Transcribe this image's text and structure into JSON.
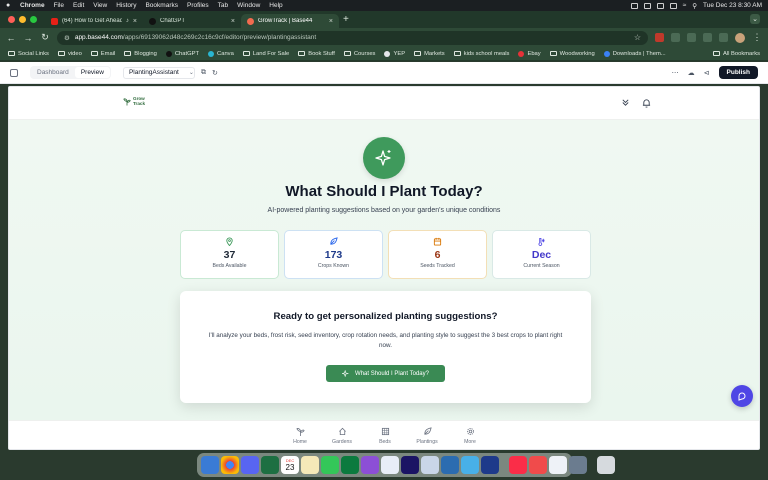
{
  "menubar": {
    "app": "Chrome",
    "menus": [
      "File",
      "Edit",
      "View",
      "History",
      "Bookmarks",
      "Profiles",
      "Tab",
      "Window",
      "Help"
    ],
    "clock": "Tue Dec 23  8:30 AM"
  },
  "browser": {
    "tabs": [
      {
        "title": "(64) How to Get Ahead o",
        "active": false
      },
      {
        "title": "ChatGPT",
        "active": false
      },
      {
        "title": "GrowTrack | Base44",
        "active": true
      }
    ],
    "url_domain": "app.base44.com",
    "url_path": "/apps/69139062d48c269c2c16c9cf/editor/preview/plantingassistant",
    "bookmarks": [
      "Social Links",
      "video",
      "Email",
      "Blogging",
      "ChatGPT",
      "Canva",
      "Land For Sale",
      "Book Stuff",
      "Courses",
      "YEP",
      "Markets",
      "kids school meals",
      "Ebay",
      "Woodworking",
      "Downloads | Them..."
    ],
    "all_bookmarks": "All Bookmarks"
  },
  "editor": {
    "tab_dashboard": "Dashboard",
    "tab_preview": "Preview",
    "page_selector": "PlantingAssistant",
    "publish": "Publish"
  },
  "app": {
    "logo_line1": "Grow",
    "logo_line2": "Track",
    "title": "What Should I Plant Today?",
    "subtitle": "AI-powered planting suggestions based on your garden's unique conditions",
    "stats": [
      {
        "value": "37",
        "label": "Beds Available",
        "color": "#1f2937",
        "icon": "map-pin-icon"
      },
      {
        "value": "173",
        "label": "Crops Known",
        "color": "#1e3a8a",
        "icon": "leaf-icon"
      },
      {
        "value": "6",
        "label": "Seeds Tracked",
        "color": "#9a3412",
        "icon": "calendar-icon"
      },
      {
        "value": "Dec",
        "label": "Current Season",
        "color": "#4338ca",
        "icon": "thermometer-snow-icon"
      }
    ],
    "card_title": "Ready to get personalized planting suggestions?",
    "card_description": "I'll analyze your beds, frost risk, seed inventory, crop rotation needs, and planting style to suggest the 3 best crops to plant right now.",
    "cta_label": "What Should I Plant Today?",
    "nav": [
      "Home",
      "Gardens",
      "Beds",
      "Plantings",
      "More"
    ],
    "accent": "#3f9a5c"
  },
  "dock": {
    "calendar_month": "DEC",
    "calendar_day": "23"
  }
}
